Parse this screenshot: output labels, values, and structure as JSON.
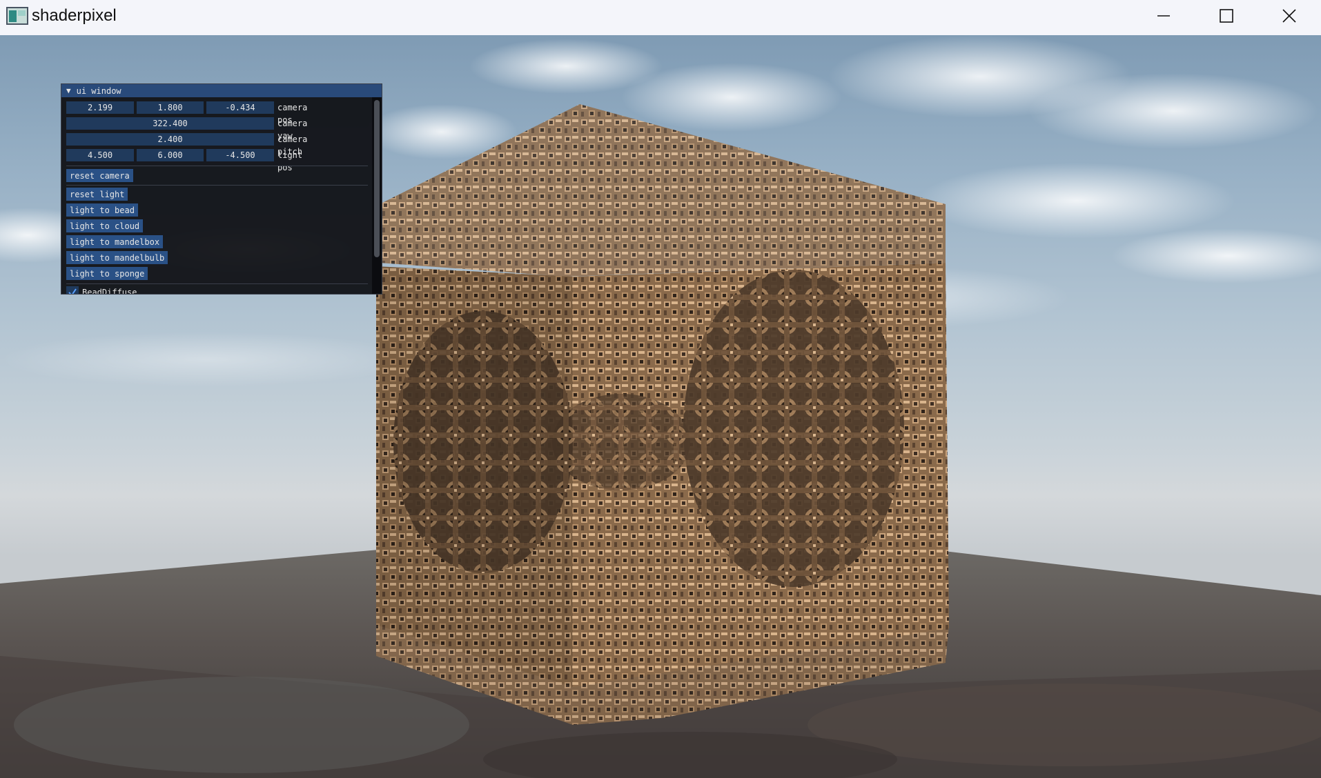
{
  "window": {
    "title": "shaderpixel",
    "icon": "app-icon",
    "controls": [
      "minimize-icon",
      "maximize-icon",
      "close-icon"
    ]
  },
  "ui_window": {
    "title": "ui window",
    "rows": {
      "camera_pos": {
        "values": [
          "2.199",
          "1.800",
          "-0.434"
        ],
        "label": "camera pos"
      },
      "camera_yaw": {
        "value": "322.400",
        "label": "camera yaw"
      },
      "camera_pitch": {
        "value": "2.400",
        "label": "camera pitch"
      },
      "light_pos": {
        "values": [
          "4.500",
          "6.000",
          "-4.500"
        ],
        "label": "light pos"
      }
    },
    "buttons": {
      "reset_camera": "reset camera",
      "reset_light": "reset light",
      "light_to_bead": "light to bead",
      "light_to_cloud": "light to cloud",
      "light_to_mandelbox": "light to mandelbox",
      "light_to_mandelbulb": "light to mandelbulb",
      "light_to_sponge": "light to sponge"
    },
    "checkbox": {
      "label": "BeadDiffuse",
      "checked": true
    }
  },
  "colors": {
    "titlebar_bg": "#f4f5fa",
    "ui_title_bg": "#294a7a",
    "ui_field_bg": "#203a5c",
    "ui_button_bg": "#2a5186",
    "fractal": "#b38b63"
  }
}
